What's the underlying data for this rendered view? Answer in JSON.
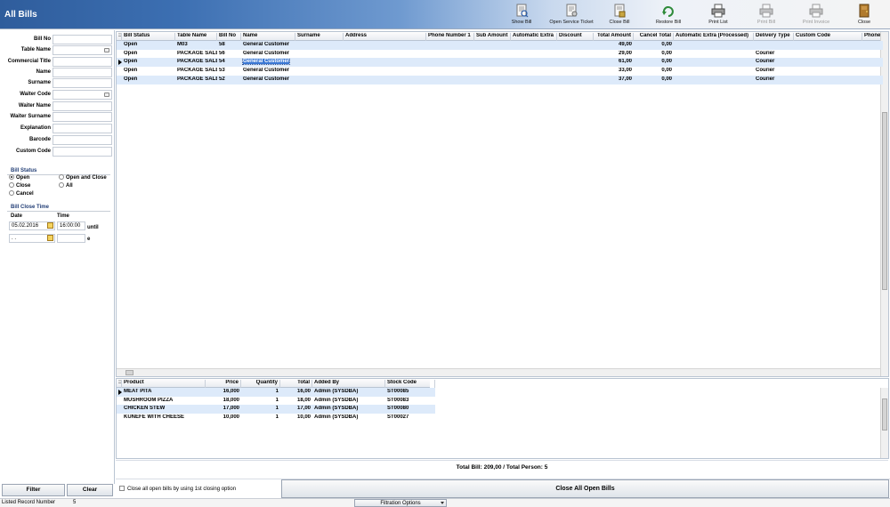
{
  "header": {
    "title": "All Bills"
  },
  "toolbar": [
    {
      "label": "Show Bill",
      "icon": "show-bill-icon",
      "enabled": true
    },
    {
      "label": "Open Service Ticket",
      "icon": "service-ticket-icon",
      "enabled": true
    },
    {
      "label": "Close Bill",
      "icon": "close-bill-icon",
      "enabled": true
    },
    {
      "label": "Restore Bill",
      "icon": "restore-bill-icon",
      "enabled": true
    },
    {
      "label": "Print List",
      "icon": "printer-icon",
      "enabled": true
    },
    {
      "label": "Print Bill",
      "icon": "printer-icon",
      "enabled": false
    },
    {
      "label": "Print Invoice",
      "icon": "printer-icon",
      "enabled": false
    },
    {
      "label": "Close",
      "icon": "door-icon",
      "enabled": true
    }
  ],
  "filters": {
    "fields": [
      {
        "label": "Bill No",
        "value": ""
      },
      {
        "label": "Table Name",
        "value": "",
        "dropdown": true
      },
      {
        "label": "Commercial Title",
        "value": ""
      },
      {
        "label": "Name",
        "value": ""
      },
      {
        "label": "Surname",
        "value": ""
      },
      {
        "label": "Waiter Code",
        "value": "",
        "dropdown": true
      },
      {
        "label": "Waiter Name",
        "value": ""
      },
      {
        "label": "Waiter Surname",
        "value": ""
      },
      {
        "label": "Explanation",
        "value": ""
      },
      {
        "label": "Barcode",
        "value": ""
      },
      {
        "label": "Custom Code",
        "value": ""
      }
    ],
    "bill_status": {
      "title": "Bill Status",
      "options": [
        "Open",
        "Close",
        "Cancel",
        "Open and Close",
        "All"
      ],
      "selected": "Open"
    },
    "bill_close_time": {
      "title": "Bill Close Time",
      "date_label": "Date",
      "time_label": "Time",
      "from_date": "05.02.2016",
      "from_time": "16:00:00",
      "until_label": "until",
      "to_date": " .  .",
      "to_time": "",
      "e_label": "e"
    },
    "filter_button": "Filter",
    "clear_button": "Clear"
  },
  "bills_grid": {
    "columns": [
      "Bill Status",
      "Table Name",
      "Bill No",
      "Name",
      "Surname",
      "Address",
      "Phone Number 1",
      "Sub Amount",
      "Automatic Extra",
      "Discount",
      "Total Amount",
      "Cancel Total",
      "Automatic Extra (Processed)",
      "Delivery Type",
      "Custom Code",
      "Phone"
    ],
    "rows": [
      [
        "Open",
        "M03",
        "58",
        "General Customer",
        "",
        "",
        "",
        "",
        "",
        "",
        "49,00",
        "0,00",
        "",
        "",
        "",
        ""
      ],
      [
        "Open",
        "PACKAGE SALE",
        "56",
        "General Customer",
        "",
        "",
        "",
        "",
        "",
        "",
        "29,00",
        "0,00",
        "",
        "Courier",
        "",
        ""
      ],
      [
        "Open",
        "PACKAGE SALE",
        "54",
        "General Customer",
        "",
        "",
        "",
        "",
        "",
        "",
        "61,00",
        "0,00",
        "",
        "Courier",
        "",
        ""
      ],
      [
        "Open",
        "PACKAGE SALE",
        "53",
        "General Customer",
        "",
        "",
        "",
        "",
        "",
        "",
        "33,00",
        "0,00",
        "",
        "Courier",
        "",
        ""
      ],
      [
        "Open",
        "PACKAGE SALE",
        "52",
        "General Customer",
        "",
        "",
        "",
        "",
        "",
        "",
        "37,00",
        "0,00",
        "",
        "Courier",
        "",
        ""
      ]
    ],
    "current_row": 2
  },
  "products_grid": {
    "columns": [
      "Product",
      "Price",
      "Quantity",
      "Total",
      "Added By",
      "Stock Code"
    ],
    "rows": [
      [
        "MEAT PITA",
        "16,000",
        "1",
        "16,00",
        "Admin  (SYSDBA)",
        "ST00085"
      ],
      [
        "MUSHROOM PİZZA",
        "18,000",
        "1",
        "18,00",
        "Admin  (SYSDBA)",
        "ST00083"
      ],
      [
        "CHICKEN STEW",
        "17,000",
        "1",
        "17,00",
        "Admin  (SYSDBA)",
        "ST00080"
      ],
      [
        "KÜNEFE WITH CHEESE",
        "10,000",
        "1",
        "10,00",
        "Admin  (SYSDBA)",
        "ST00027"
      ]
    ],
    "current_row": 0
  },
  "totals_text": "Total Bill: 209,00  /  Total Person: 5",
  "close_all_checkbox": "Close all open bills by using 1st closing option",
  "close_all_button": "Close All Open Bills",
  "status_bar": {
    "listed_label": "Listed Record Number",
    "listed_value": "5",
    "filtration": "Filtration Options"
  }
}
